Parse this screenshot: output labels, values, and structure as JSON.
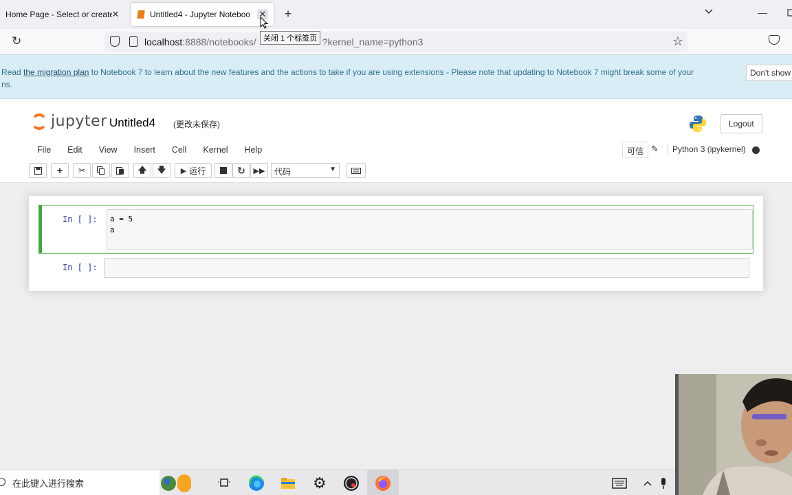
{
  "browser": {
    "tabs": [
      {
        "title": "Home Page - Select or create",
        "active": false
      },
      {
        "title": "Untitled4 - Jupyter Noteboo",
        "active": true
      }
    ],
    "tab_close_tooltip": "关闭 1 个标签页",
    "url_host": "localhost",
    "url_rest": ":8888/notebooks/",
    "url_tail": "?kernel_name=python3"
  },
  "banner": {
    "prefix": "Read ",
    "link_text": "the migration plan",
    "text": " to Notebook 7 to learn about the new features and the actions to take if you are using extensions - Please note that updating to Notebook 7 might break some of your",
    "text_line2": "ns.",
    "dont_show_button": "Don't show a"
  },
  "header": {
    "logo_text": "jupyter",
    "notebook_name": "Untitled4",
    "save_status": "(更改未保存)",
    "logout_label": "Logout"
  },
  "menu": {
    "items": [
      "File",
      "Edit",
      "View",
      "Insert",
      "Cell",
      "Kernel",
      "Help"
    ],
    "trusted_label": "可信",
    "kernel_name": "Python 3 (ipykernel)"
  },
  "toolbar": {
    "run_label": "运行",
    "cell_type": "代码"
  },
  "cells": [
    {
      "prompt": "In [ ]:",
      "code_lines": [
        "a = 5",
        "a"
      ],
      "selected": true
    },
    {
      "prompt": "In [ ]:",
      "code_lines": [],
      "selected": false
    }
  ],
  "taskbar": {
    "search_placeholder": "在此键入进行搜索"
  },
  "colors": {
    "jupyter_orange": "#f37726",
    "banner_bg": "#d9edf7",
    "selected_cell_border": "#42a642"
  }
}
